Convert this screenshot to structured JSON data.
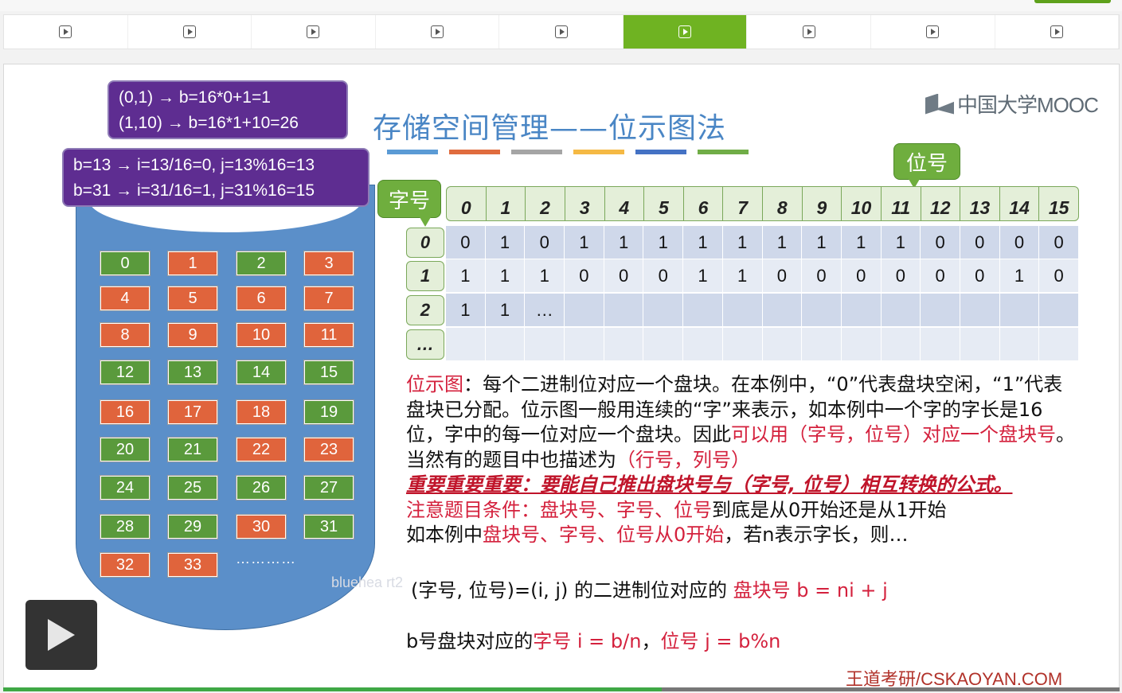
{
  "player": {
    "chapters": [
      "",
      "",
      "",
      "",
      "",
      "",
      "",
      "",
      ""
    ],
    "active_chapter": 6,
    "progress_percent": 59
  },
  "slide": {
    "title": "存储空间管理——位示图法",
    "title_bar_colors": [
      "#5b9bd5",
      "#e06c3e",
      "#a5a5a5",
      "#f5b944",
      "#4472c4",
      "#70ad47"
    ],
    "logo": "中国大学MOOC",
    "callout_top": [
      "(0,1) → b=16*0+1=1",
      "(1,10) → b=16*1+10=26"
    ],
    "callout_bottom": [
      "b=13 → i=13/16=0, j=13%16=13",
      "b=31 → i=31/16=1, j=31%16=15"
    ],
    "disk_blocks": [
      {
        "n": "0",
        "color": "green"
      },
      {
        "n": "1",
        "color": "orange"
      },
      {
        "n": "2",
        "color": "green"
      },
      {
        "n": "3",
        "color": "orange"
      },
      {
        "n": "4",
        "color": "orange"
      },
      {
        "n": "5",
        "color": "orange"
      },
      {
        "n": "6",
        "color": "orange"
      },
      {
        "n": "7",
        "color": "orange"
      },
      {
        "n": "8",
        "color": "orange"
      },
      {
        "n": "9",
        "color": "orange"
      },
      {
        "n": "10",
        "color": "orange"
      },
      {
        "n": "11",
        "color": "orange"
      },
      {
        "n": "12",
        "color": "green"
      },
      {
        "n": "13",
        "color": "green"
      },
      {
        "n": "14",
        "color": "green"
      },
      {
        "n": "15",
        "color": "green"
      },
      {
        "n": "16",
        "color": "orange"
      },
      {
        "n": "17",
        "color": "orange"
      },
      {
        "n": "18",
        "color": "orange"
      },
      {
        "n": "19",
        "color": "green"
      },
      {
        "n": "20",
        "color": "green"
      },
      {
        "n": "21",
        "color": "green"
      },
      {
        "n": "22",
        "color": "orange"
      },
      {
        "n": "23",
        "color": "orange"
      },
      {
        "n": "24",
        "color": "green"
      },
      {
        "n": "25",
        "color": "green"
      },
      {
        "n": "26",
        "color": "green"
      },
      {
        "n": "27",
        "color": "green"
      },
      {
        "n": "28",
        "color": "green"
      },
      {
        "n": "29",
        "color": "green"
      },
      {
        "n": "30",
        "color": "orange"
      },
      {
        "n": "31",
        "color": "green"
      },
      {
        "n": "32",
        "color": "orange"
      },
      {
        "n": "33",
        "color": "orange"
      }
    ],
    "disk_more": "…………",
    "label_bit": "位号",
    "label_word": "字号",
    "bit_headers": [
      "0",
      "1",
      "2",
      "3",
      "4",
      "5",
      "6",
      "7",
      "8",
      "9",
      "10",
      "11",
      "12",
      "13",
      "14",
      "15"
    ],
    "row_labels": [
      "0",
      "1",
      "2",
      "…"
    ],
    "rows": [
      [
        "0",
        "1",
        "0",
        "1",
        "1",
        "1",
        "1",
        "1",
        "1",
        "1",
        "1",
        "1",
        "0",
        "0",
        "0",
        "0"
      ],
      [
        "1",
        "1",
        "1",
        "0",
        "0",
        "0",
        "1",
        "1",
        "0",
        "0",
        "0",
        "0",
        "0",
        "0",
        "1",
        "0"
      ],
      [
        "1",
        "1",
        "…",
        "",
        "",
        "",
        "",
        "",
        "",
        "",
        "",
        "",
        "",
        "",
        "",
        ""
      ],
      [
        "",
        "",
        "",
        "",
        "",
        "",
        "",
        "",
        "",
        "",
        "",
        "",
        "",
        "",
        "",
        ""
      ]
    ],
    "para": {
      "s1_red": "位示图",
      "s1": "：每个二进制位对应一个盘块。在本例中，“0”代表盘块空闲，“1”代表盘块已分配。位示图一般用连续的“字”来表示，如本例中一个字的字长是16位，字中的每一位对应一个盘块。因此",
      "s2_red": "可以用（字号，位号）对应一个盘块号",
      "s3": "。当然有的题目中也描述为",
      "s4_red": "（行号，列号）",
      "important": "重要重要重要：要能自己推出盘块号与（字号, 位号）相互转换的公式。",
      "note_red": "注意题目条件：盘块号、字号、位号",
      "note": "到底是从0开始还是从1开始",
      "ex1": "如本例中",
      "ex2_red": "盘块号、字号、位号从0开始",
      "ex3": "，若n表示字长，则…"
    },
    "formula1": {
      "a": "(字号, 位号)=(i, j) 的二进制位对应的 ",
      "b_red": "盘块号 b = ni + j"
    },
    "formula2": {
      "a": "b号盘块对应的",
      "b_red": "字号 i = b/n",
      "c": "，",
      "d_red": "位号 j = b%n"
    },
    "footer": "王道考研/CSKAOYAN.COM",
    "watermark": "bluehea  rt2"
  }
}
